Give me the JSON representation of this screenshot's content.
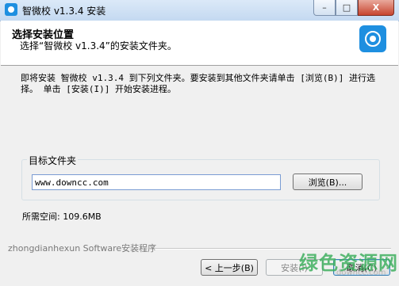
{
  "window": {
    "title": "智微校 v1.3.4 安装",
    "min_label": "–",
    "max_label": "□",
    "close_label": "X"
  },
  "header": {
    "title": "选择安装位置",
    "subtitle": "选择“智微校 v1.3.4”的安装文件夹。"
  },
  "description": "即将安装 智微校 v1.3.4 到下列文件夹。要安装到其他文件夹请单击 [浏览(B)] 进行选择。 单击 [安装(I)] 开始安装进程。",
  "target": {
    "group_label": "目标文件夹",
    "path_value": "www.downcc.com",
    "browse_label": "浏览(B)..."
  },
  "space_required": "所需空间: 109.6MB",
  "branding": "zhongdianhexun Software安装程序",
  "buttons": {
    "back": "< 上一步(B)",
    "install": "安装(I)",
    "cancel": "取消(C)"
  },
  "watermark": {
    "text": "绿色资源网",
    "url": "downcc.com"
  },
  "colors": {
    "accent": "#1e8fe0",
    "watermark": "#40b060"
  }
}
